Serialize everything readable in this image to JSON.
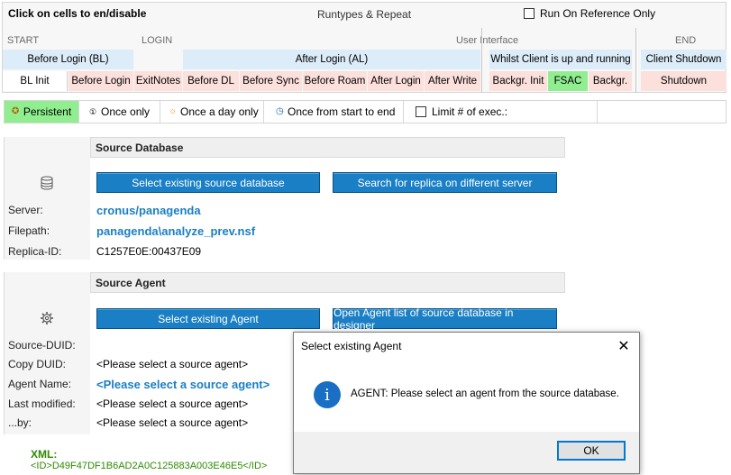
{
  "top": {
    "click_label": "Click on cells to en/disable",
    "runtypes_label": "Runtypes & Repeat",
    "run_on_reference_label": "Run On Reference Only",
    "phase_labels": {
      "start": "START",
      "login": "LOGIN",
      "ui": "User Interface",
      "end": "END"
    },
    "bands": {
      "before_login": "Before Login (BL)",
      "after_login": "After Login (AL)",
      "whilst_client": "Whilst Client is up and running",
      "client_shutdown": "Client Shutdown"
    },
    "cells": [
      {
        "label": "BL Init",
        "state": "white"
      },
      {
        "label": "Before Login",
        "state": "pink"
      },
      {
        "label": "ExitNotes",
        "state": "pink"
      },
      {
        "label": "Before DL",
        "state": "pink"
      },
      {
        "label": "Before Sync",
        "state": "pink"
      },
      {
        "label": "Before Roam",
        "state": "pink"
      },
      {
        "label": "After Login",
        "state": "pink"
      },
      {
        "label": "After Write",
        "state": "pink"
      },
      {
        "label": "Backgr. Init",
        "state": "pink"
      },
      {
        "label": "FSAC",
        "state": "green"
      },
      {
        "label": "Backgr.",
        "state": "pink"
      },
      {
        "label": "Shutdown",
        "state": "pink"
      }
    ]
  },
  "frequency": {
    "persistent": "Persistent",
    "once_only": "Once only",
    "once_a_day": "Once a day only",
    "once_start_end": "Once from start to end",
    "limit": "Limit # of exec.:"
  },
  "source_db": {
    "title": "Source Database",
    "btn_select": "Select existing source database",
    "btn_search": "Search for replica on different server",
    "server_label": "Server:",
    "server_value": "cronus/panagenda",
    "filepath_label": "Filepath:",
    "filepath_value": "panagenda\\analyze_prev.nsf",
    "replica_label": "Replica-ID:",
    "replica_value": "C1257E0E:00437E09"
  },
  "source_agent": {
    "title": "Source Agent",
    "btn_select": "Select existing Agent",
    "btn_open": "Open Agent list of source database in designer",
    "duid_label": "Source-DUID:",
    "copy_duid_label": "Copy DUID:",
    "copy_duid_value": "<Please select a source agent>",
    "agent_name_label": "Agent Name:",
    "agent_name_value": "<Please select a source agent>",
    "last_modified_label": "Last modified:",
    "last_modified_value": "<Please select a source agent>",
    "by_label": "...by:",
    "by_value": "<Please select a source agent>"
  },
  "xml": {
    "label": "XML:",
    "line1": "<ID>D49F47DF1B6AD2A0C125883A003E46E5</ID>"
  },
  "dialog": {
    "title": "Select existing Agent",
    "message": "AGENT: Please select an agent from the source database.",
    "ok": "OK"
  },
  "colors": {
    "accent_blue": "#1a7fc4",
    "band_blue": "#dcecf8",
    "pink": "#fbe0dc",
    "green": "#90ee90"
  }
}
